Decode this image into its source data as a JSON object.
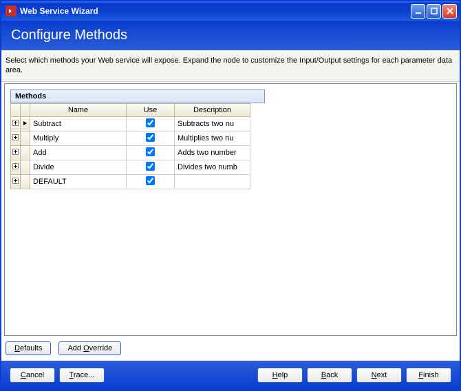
{
  "window": {
    "title": "Web Service Wizard"
  },
  "header": {
    "title": "Configure Methods"
  },
  "instruction": "Select which methods your Web service will expose. Expand the node to customize the Input/Output settings for each parameter data area.",
  "grid": {
    "title": "Methods",
    "columns": {
      "name": "Name",
      "use": "Use",
      "description": "Description"
    },
    "rows": [
      {
        "name": "Subtract",
        "use": true,
        "description": "Subtracts two nu",
        "current": true
      },
      {
        "name": "Multiply",
        "use": true,
        "description": "Multiplies two nu",
        "current": false
      },
      {
        "name": "Add",
        "use": true,
        "description": "Adds two number",
        "current": false
      },
      {
        "name": "Divide",
        "use": true,
        "description": "Divides two numb",
        "current": false
      },
      {
        "name": "DEFAULT",
        "use": true,
        "description": "",
        "current": false
      }
    ]
  },
  "buttons": {
    "defaults": {
      "u": "D",
      "rest": "efaults"
    },
    "addOverride": {
      "pre": "Add ",
      "u": "O",
      "rest": "verride"
    },
    "cancel": {
      "u": "C",
      "rest": "ancel"
    },
    "trace": {
      "u": "T",
      "rest": "race..."
    },
    "help": {
      "u": "H",
      "rest": "elp"
    },
    "back": {
      "u": "B",
      "rest": "ack"
    },
    "next": {
      "u": "N",
      "rest": "ext"
    },
    "finish": {
      "u": "F",
      "rest": "inish"
    }
  }
}
